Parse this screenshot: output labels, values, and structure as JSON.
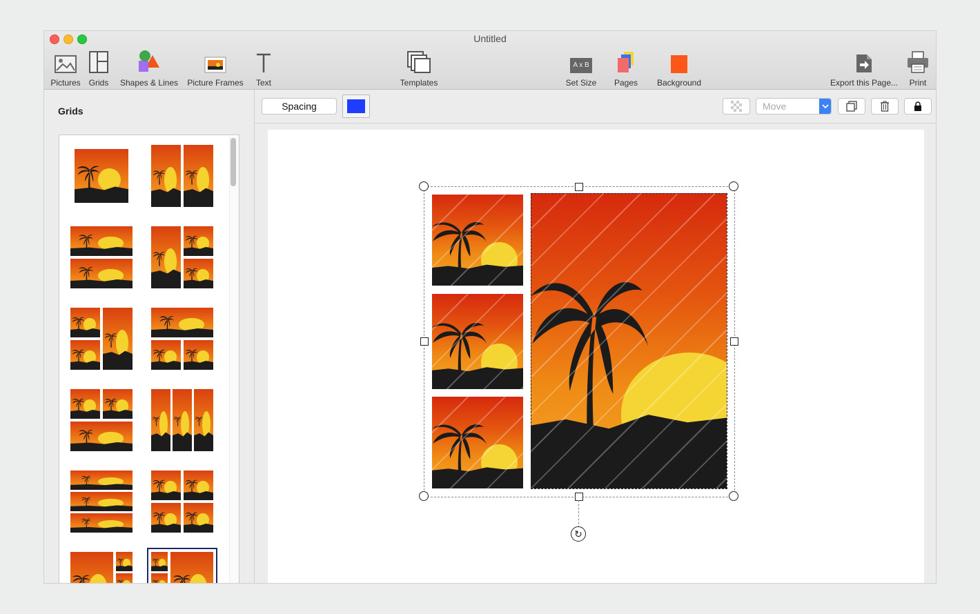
{
  "window": {
    "title": "Untitled"
  },
  "toolbar": {
    "pictures": "Pictures",
    "grids": "Grids",
    "shapes": "Shapes & Lines",
    "frames": "Picture Frames",
    "text": "Text",
    "templates": "Templates",
    "set_size": "Set Size",
    "set_size_icon_text": "A x B",
    "pages": "Pages",
    "background": "Background",
    "export": "Export this Page...",
    "print": "Print"
  },
  "sidebar": {
    "title": "Grids"
  },
  "format_bar": {
    "spacing_label": "Spacing",
    "spacing_color": "#1f3dff",
    "move_select_value": "Move"
  },
  "colors": {
    "background_swatch": "#fc5719",
    "accent_blue": "#3b82f6"
  },
  "icons": [
    "pictures-icon",
    "grids-icon",
    "shapes-icon",
    "frames-icon",
    "text-icon",
    "templates-icon",
    "set-size-icon",
    "pages-icon",
    "background-icon",
    "export-icon",
    "print-icon",
    "checker-icon",
    "chevron-down-icon",
    "duplicate-icon",
    "trash-icon",
    "lock-icon",
    "rotate-icon"
  ]
}
